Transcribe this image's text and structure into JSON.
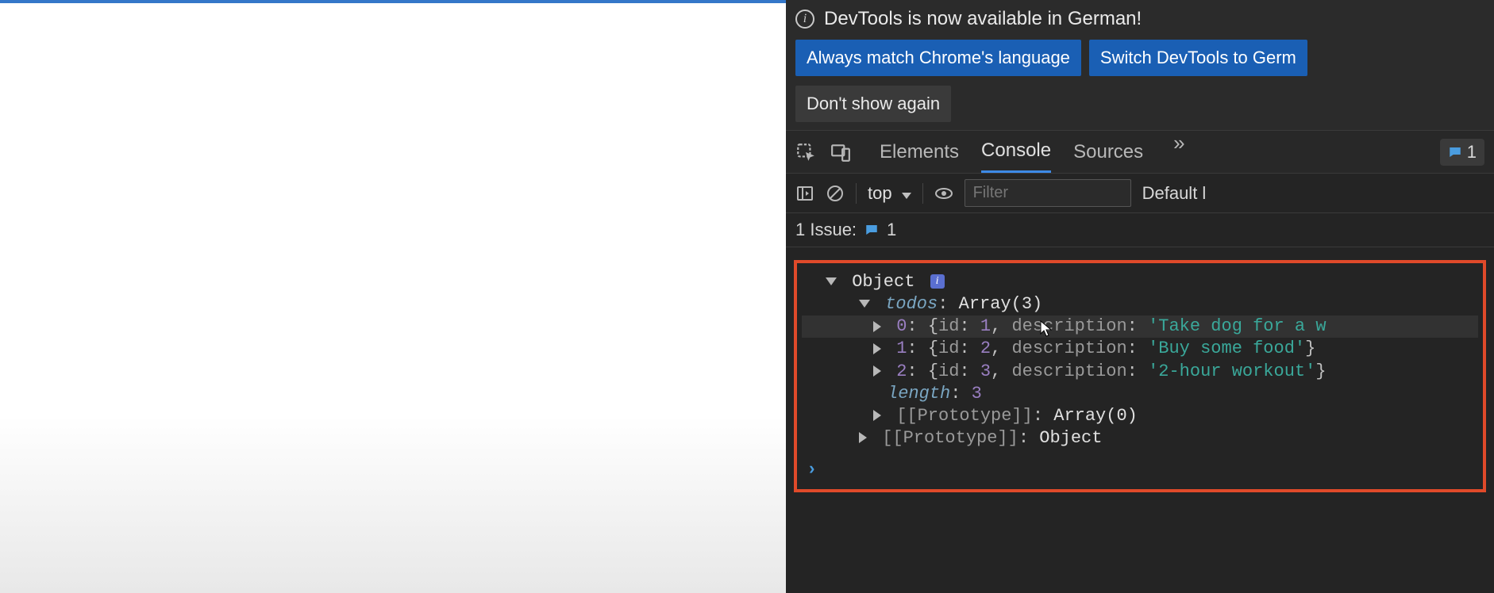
{
  "banner": {
    "message": "DevTools is now available in German!",
    "btn_match": "Always match Chrome's language",
    "btn_switch": "Switch DevTools to Germ",
    "btn_dismiss": "Don't show again"
  },
  "tabs": {
    "elements": "Elements",
    "console": "Console",
    "sources": "Sources",
    "overflow": "»",
    "issues_badge": "1"
  },
  "toolbar": {
    "context": "top",
    "filter_placeholder": "Filter",
    "levels": "Default l"
  },
  "issues_row": {
    "label": "1 Issue:",
    "count": "1"
  },
  "console": {
    "object_label": "Object",
    "todos_key": "todos",
    "todos_type": "Array(3)",
    "items": [
      {
        "index": "0",
        "id": "1",
        "desc": "'Take dog for a w"
      },
      {
        "index": "1",
        "id": "2",
        "desc": "'Buy some food'"
      },
      {
        "index": "2",
        "id": "3",
        "desc": "'2-hour workout'"
      }
    ],
    "length_key": "length",
    "length_val": "3",
    "proto_label": "[[Prototype]]",
    "proto_arr": "Array(0)",
    "proto_obj": "Object",
    "prompt": "›",
    "id_lbl": "id",
    "desc_lbl": "description",
    "brace_open": "{",
    "brace_close": "}",
    "comma": ", ",
    "colon": ": "
  }
}
